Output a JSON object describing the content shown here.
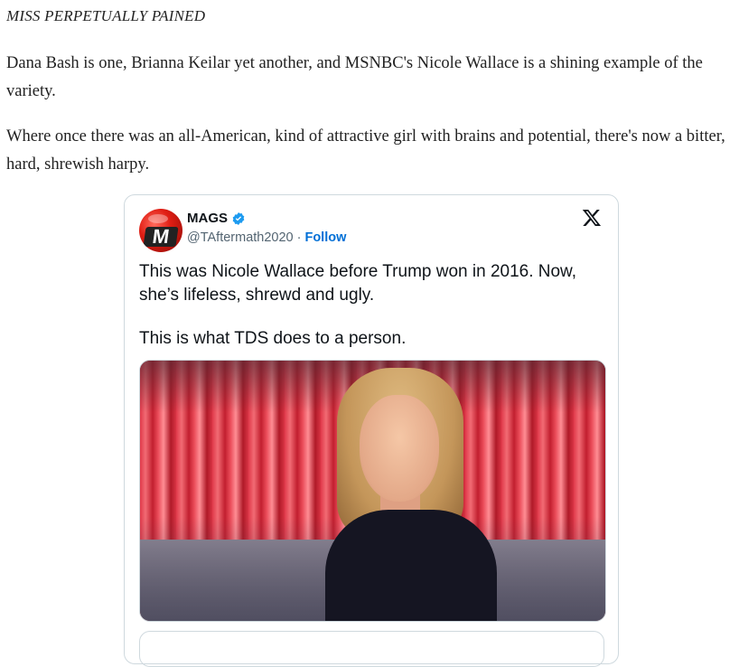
{
  "article": {
    "heading": "MISS PERPETUALLY PAINED",
    "paragraphs": [
      "Dana Bash is one, Brianna Keilar yet another, and MSNBC's Nicole Wallace is a shining example of the variety.",
      "Where once there was an all-American, kind of attractive girl with brains and potential, there's now a bitter, hard, shrewish harpy."
    ]
  },
  "tweet": {
    "author_name": "MAGS",
    "avatar_letter": "M",
    "handle": "@TAftermath2020",
    "separator": "·",
    "follow_label": "Follow",
    "text_line1": "This was Nicole Wallace before Trump won in 2016. Now, she’s lifeless, shrewd and ugly.",
    "text_line2": "This is what TDS does to a person.",
    "icons": {
      "verified": "verified-badge-icon",
      "x_logo": "x-logo-icon"
    },
    "colors": {
      "follow": "#006fd6",
      "verified": "#1d9bf0",
      "border": "#cfd9de"
    }
  }
}
